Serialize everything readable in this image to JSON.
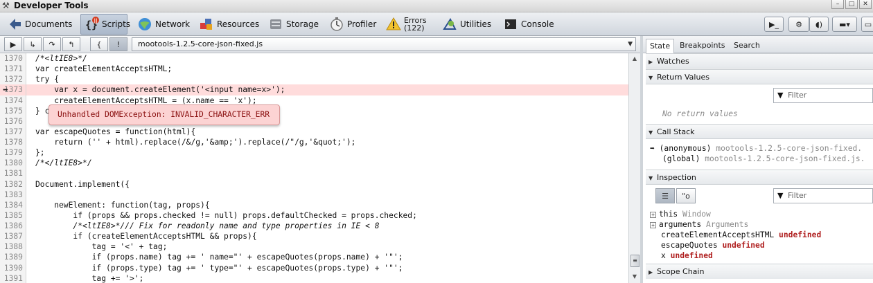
{
  "window": {
    "title": "Developer Tools"
  },
  "toolbar": {
    "panels": [
      {
        "label": "Documents",
        "icon": "documents-icon"
      },
      {
        "label": "Scripts",
        "icon": "scripts-icon",
        "badge": "||"
      },
      {
        "label": "Network",
        "icon": "network-icon"
      },
      {
        "label": "Resources",
        "icon": "resources-icon"
      },
      {
        "label": "Storage",
        "icon": "storage-icon"
      },
      {
        "label": "Profiler",
        "icon": "profiler-icon"
      },
      {
        "label": "Errors",
        "sub": "(122)",
        "icon": "errors-icon"
      },
      {
        "label": "Utilities",
        "icon": "utilities-icon"
      },
      {
        "label": "Console",
        "icon": "console-icon"
      }
    ],
    "right_buttons": [
      "console-toggle-icon",
      "settings-icon",
      "audio-icon",
      "window-icon",
      "more-icon"
    ]
  },
  "scripts": {
    "file_select": "mootools-1.2.5-core-json-fixed.js",
    "error_popup": "Unhandled DOMException: INVALID_CHARACTER_ERR",
    "lines": [
      {
        "n": "1370",
        "t": "/*<ltIE8>*/"
      },
      {
        "n": "1371",
        "t": "var createElementAcceptsHTML;"
      },
      {
        "n": "1372",
        "t": "try {"
      },
      {
        "n": "1373",
        "t": "    var x = document.createElement('<input name=x>');"
      },
      {
        "n": "1374",
        "t": "    createElementAcceptsHTML = (x.name == 'x');"
      },
      {
        "n": "1375",
        "t": "} c"
      },
      {
        "n": "1376",
        "t": ""
      },
      {
        "n": "1377",
        "t": "var escapeQuotes = function(html){"
      },
      {
        "n": "1378",
        "t": "    return ('' + html).replace(/&/g,'&amp;').replace(/\"/g,'&quot;');"
      },
      {
        "n": "1379",
        "t": "};"
      },
      {
        "n": "1380",
        "t": "/*</ltIE8>*/"
      },
      {
        "n": "1381",
        "t": ""
      },
      {
        "n": "1382",
        "t": "Document.implement({"
      },
      {
        "n": "1383",
        "t": ""
      },
      {
        "n": "1384",
        "t": "    newElement: function(tag, props){"
      },
      {
        "n": "1385",
        "t": "        if (props && props.checked != null) props.defaultChecked = props.checked;"
      },
      {
        "n": "1386",
        "t": "        /*<ltIE8>*/// Fix for readonly name and type properties in IE < 8"
      },
      {
        "n": "1387",
        "t": "        if (createElementAcceptsHTML && props){"
      },
      {
        "n": "1388",
        "t": "            tag = '<' + tag;"
      },
      {
        "n": "1389",
        "t": "            if (props.name) tag += ' name=\"' + escapeQuotes(props.name) + '\"';"
      },
      {
        "n": "1390",
        "t": "            if (props.type) tag += ' type=\"' + escapeQuotes(props.type) + '\"';"
      },
      {
        "n": "1391",
        "t": "            tag += '>';"
      }
    ]
  },
  "sidebar": {
    "tabs": [
      "State",
      "Breakpoints",
      "Search"
    ],
    "watches": "Watches",
    "return_values": {
      "title": "Return Values",
      "filter_placeholder": "Filter",
      "empty": "No return values"
    },
    "call_stack": {
      "title": "Call Stack",
      "frames": [
        {
          "fn": "(anonymous)",
          "file": "mootools-1.2.5-core-json-fixed."
        },
        {
          "fn": "(global)",
          "file": "mootools-1.2.5-core-json-fixed.js."
        }
      ]
    },
    "inspection": {
      "title": "Inspection",
      "filter_placeholder": "Filter",
      "vars": [
        {
          "name": "this",
          "value": "Window",
          "expandable": true
        },
        {
          "name": "arguments",
          "value": "Arguments",
          "expandable": true
        },
        {
          "name": "createElementAcceptsHTML",
          "value": "undefined"
        },
        {
          "name": "escapeQuotes",
          "value": "undefined"
        },
        {
          "name": "x",
          "value": "undefined"
        }
      ]
    },
    "scope_chain": "Scope Chain"
  }
}
